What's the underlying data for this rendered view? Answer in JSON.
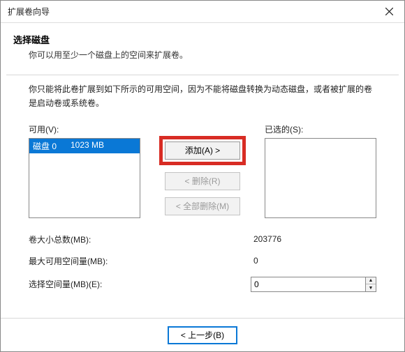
{
  "title": "扩展卷向导",
  "header": {
    "h1": "选择磁盘",
    "h2": "你可以用至少一个磁盘上的空间来扩展卷。"
  },
  "desc": "你只能将此卷扩展到如下所示的可用空间，因为不能将磁盘转换为动态磁盘，或者被扩展的卷是启动卷或系统卷。",
  "labels": {
    "available": "可用(V):",
    "selected": "已选的(S):",
    "add": "添加(A) >",
    "remove": "< 删除(R)",
    "removeAll": "< 全部删除(M)",
    "totalSize": "卷大小总数(MB):",
    "maxAvail": "最大可用空间量(MB):",
    "selectSize": "选择空间量(MB)(E):",
    "back": "< 上一步(B)"
  },
  "available_list": [
    {
      "disk": "磁盘 0",
      "size": "1023 MB",
      "selected": true
    }
  ],
  "selected_list": [],
  "values": {
    "totalSize": "203776",
    "maxAvail": "0",
    "selectSize": "0"
  }
}
